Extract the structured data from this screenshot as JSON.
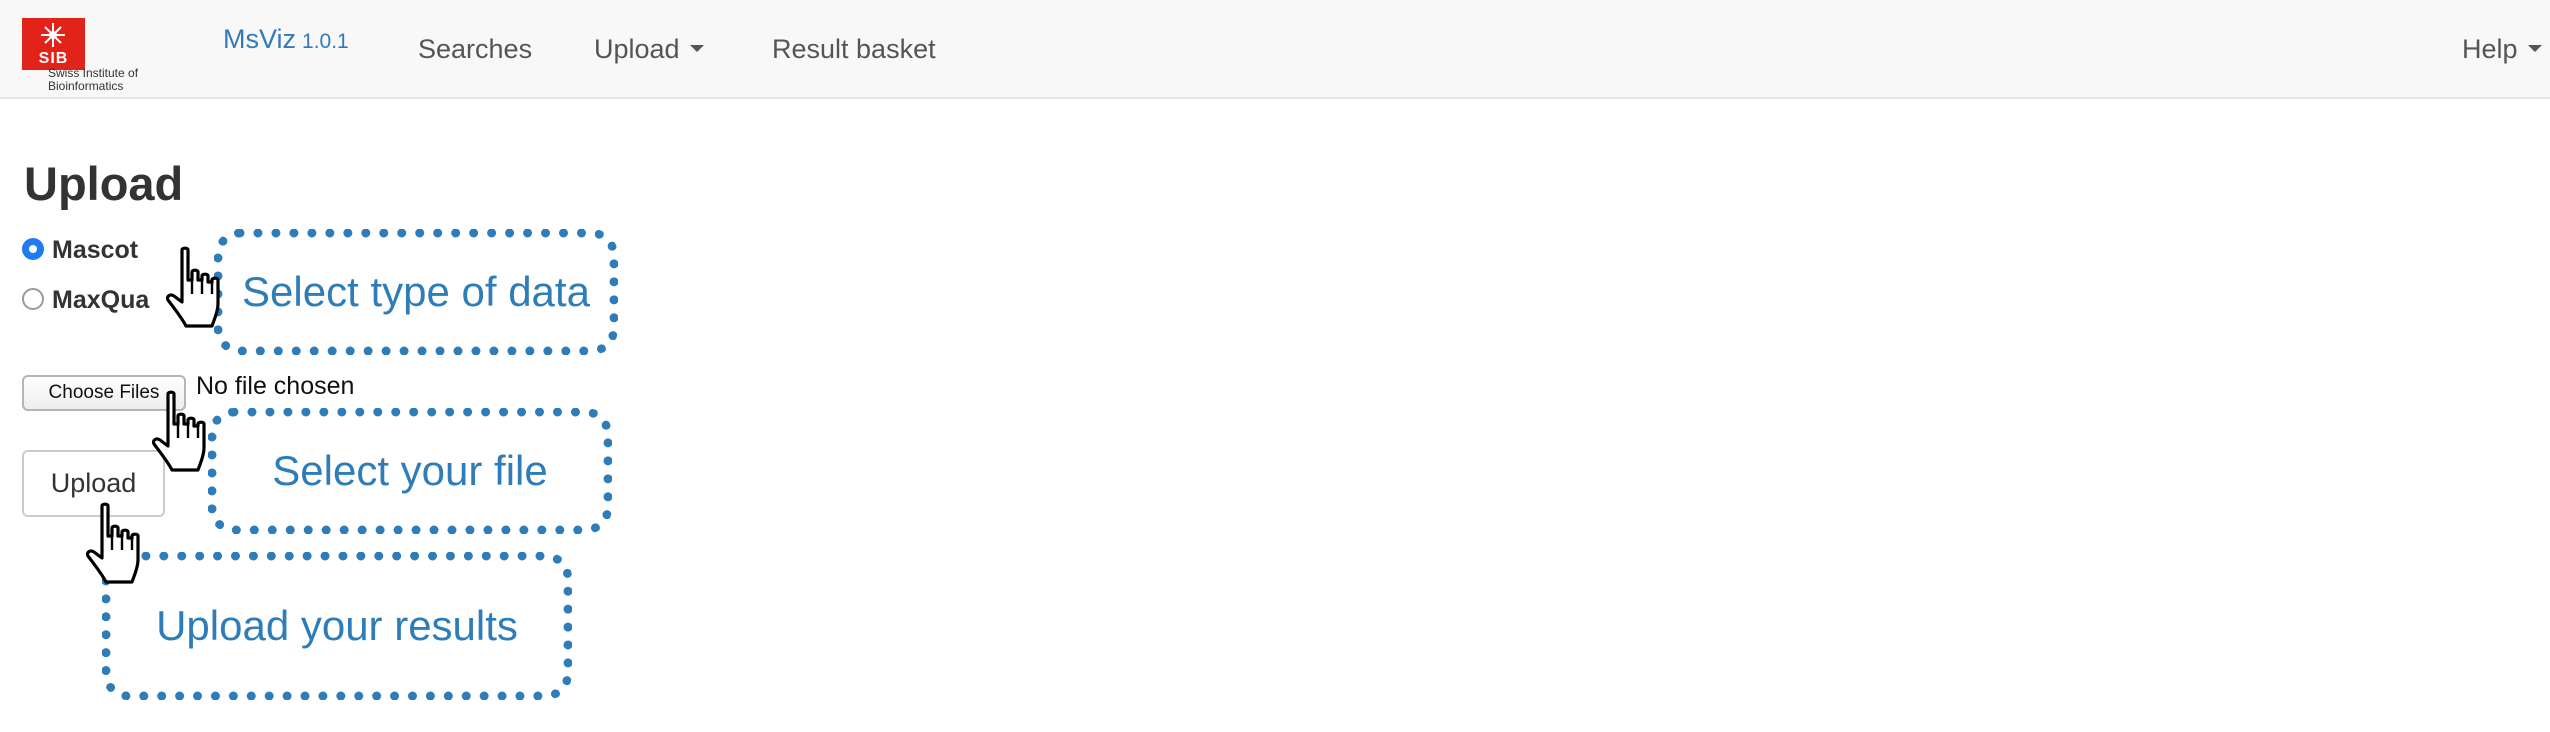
{
  "navbar": {
    "logo": {
      "letters": "SIB",
      "subtitle": "Swiss Institute of\nBioinformatics",
      "logo_color": "#e2231a"
    },
    "brand": {
      "name": "MsViz",
      "version": "1.0.1"
    },
    "items": [
      {
        "label": "Searches",
        "has_caret": false
      },
      {
        "label": "Upload",
        "has_caret": true
      },
      {
        "label": "Result basket",
        "has_caret": false
      }
    ],
    "help": {
      "label": "Help",
      "has_caret": true
    }
  },
  "page": {
    "title": "Upload",
    "data_type_options": [
      {
        "label": "Mascot",
        "selected": true
      },
      {
        "label": "MaxQua",
        "selected": false
      }
    ],
    "file_input": {
      "button_label": "Choose Files",
      "status": "No file chosen"
    },
    "upload_button": {
      "label": "Upload"
    }
  },
  "annotations": {
    "select_type": "Select type of data",
    "select_file": "Select your file",
    "upload_results": "Upload your results",
    "callout_color": "#2e7db8",
    "cursor_icon": "hand-pointer-icon"
  },
  "colors": {
    "brand": "#337ab7",
    "navbar_bg": "#f8f8f8",
    "radio_selected": "#1f7cf0"
  }
}
